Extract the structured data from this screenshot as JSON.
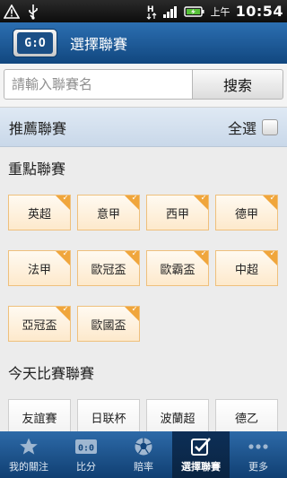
{
  "status_bar": {
    "ampm": "上午",
    "time": "10:54",
    "icons": [
      "warning-icon",
      "usb-icon",
      "signal-data-icon",
      "signal-bars-icon",
      "battery-icon"
    ]
  },
  "app": {
    "logo_text": "G:O",
    "title": "選擇聯賽"
  },
  "search": {
    "placeholder": "請輸入聯賽名",
    "button_label": "搜索"
  },
  "recommended": {
    "title": "推薦聯賽",
    "select_all_label": "全選",
    "select_all_checked": false
  },
  "sections": [
    {
      "title": "重點聯賽",
      "leagues": [
        {
          "label": "英超",
          "selected": true
        },
        {
          "label": "意甲",
          "selected": true
        },
        {
          "label": "西甲",
          "selected": true
        },
        {
          "label": "德甲",
          "selected": true
        },
        {
          "label": "法甲",
          "selected": true
        },
        {
          "label": "歐冠盃",
          "selected": true
        },
        {
          "label": "歐霸盃",
          "selected": true
        },
        {
          "label": "中超",
          "selected": true
        },
        {
          "label": "亞冠盃",
          "selected": true
        },
        {
          "label": "歐國盃",
          "selected": true
        }
      ]
    },
    {
      "title": "今天比賽聯賽",
      "leagues": [
        {
          "label": "友誼賽",
          "selected": false
        },
        {
          "label": "日联杯",
          "selected": false
        },
        {
          "label": "波蘭超",
          "selected": false
        },
        {
          "label": "德乙",
          "selected": false
        }
      ]
    }
  ],
  "bottom_nav": [
    {
      "label": "我的關注",
      "icon": "star-icon",
      "active": false
    },
    {
      "label": "比分",
      "icon": "scoreboard-icon",
      "active": false
    },
    {
      "label": "賠率",
      "icon": "soccer-ball-icon",
      "active": false
    },
    {
      "label": "選擇聯賽",
      "icon": "checkbox-icon",
      "active": true
    },
    {
      "label": "更多",
      "icon": "more-icon",
      "active": false
    }
  ],
  "colors": {
    "app_bar": "#1a5a97",
    "tile_selected_border": "#efc07c",
    "tile_check": "#f0a63c"
  }
}
